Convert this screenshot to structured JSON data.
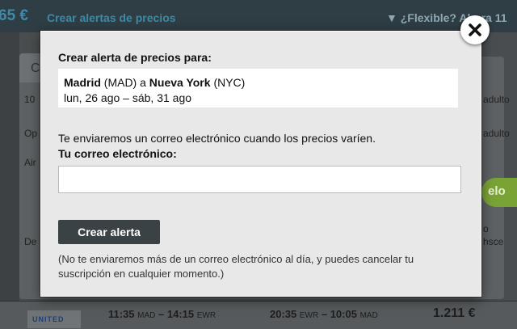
{
  "background": {
    "price_fragment": "65 €",
    "create_alerts_link": "Crear alertas de precios",
    "flexible_toggle": "▼ ¿Flexible? Ahora 11",
    "tab_fragment": "C",
    "left_fragments": [
      "10",
      "Op",
      "Air",
      "De"
    ],
    "right_fragments": [
      "adulto",
      "adulto",
      "elo",
      "o",
      "hsce"
    ],
    "green_fragment": "elo",
    "footer": {
      "airline_logo": "UNITED",
      "out_depart_time": "11:35",
      "out_depart_code": "MAD",
      "out_arrive_time": "14:15",
      "out_arrive_code": "EWR",
      "ret_depart_time": "20:35",
      "ret_depart_code": "EWR",
      "ret_arrive_time": "10:05",
      "ret_arrive_code": "MAD",
      "price": "1.211 €",
      "dash": "–"
    }
  },
  "modal": {
    "title": "Crear alerta de precios para:",
    "route": {
      "origin_city": "Madrid",
      "origin_code": "(MAD)",
      "connector": "a",
      "dest_city": "Nueva York",
      "dest_code": "(NYC)",
      "dates": "lun, 26 ago – sáb, 31 ago"
    },
    "info_text": "Te enviaremos un correo electrónico cuando los precios varíen.",
    "email_label": "Tu correo electrónico:",
    "email_value": "",
    "email_placeholder": "",
    "create_button": "Crear alerta",
    "note": "(No te enviaremos más de un correo electrónico al día, y puedes cancelar tu suscripción en cualquier momento.)"
  },
  "icons": {
    "close": "close-icon",
    "bell": "bell-icon"
  }
}
